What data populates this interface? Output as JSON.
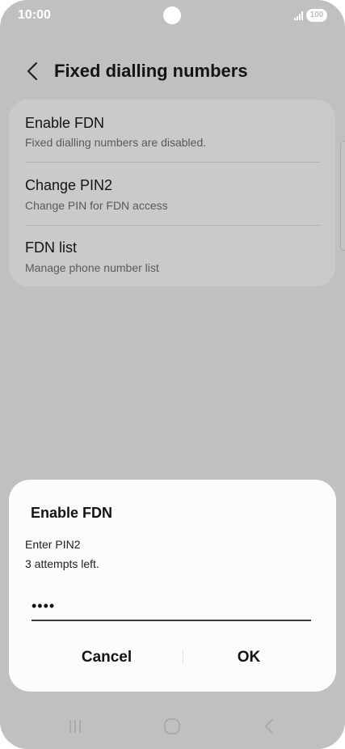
{
  "status_bar": {
    "time": "10:00",
    "battery": "100",
    "signal_icon": "signal-icon",
    "battery_icon": "battery-icon"
  },
  "header": {
    "back_icon": "chevron-left-icon",
    "title": "Fixed dialling numbers"
  },
  "settings": {
    "items": [
      {
        "title": "Enable FDN",
        "subtitle": "Fixed dialling numbers are disabled."
      },
      {
        "title": "Change PIN2",
        "subtitle": "Change PIN for FDN access"
      },
      {
        "title": "FDN list",
        "subtitle": "Manage phone number list"
      }
    ]
  },
  "dialog": {
    "title": "Enable FDN",
    "message_line1": "Enter PIN2",
    "message_line2": "3 attempts left.",
    "pin_value": "••••",
    "cancel_label": "Cancel",
    "ok_label": "OK"
  },
  "nav_bar": {
    "recents_icon": "recents-icon",
    "home_icon": "home-icon",
    "back_icon": "back-icon"
  },
  "colors": {
    "dimmed_background": "#c0c0c0",
    "card_background": "#cacaca",
    "dialog_background": "#fcfcfd",
    "text_primary": "#141414",
    "text_secondary": "#5a5a5a"
  }
}
